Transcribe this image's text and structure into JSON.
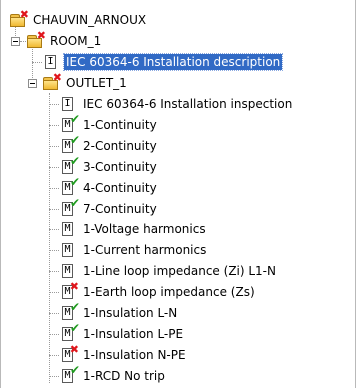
{
  "tree": {
    "root": {
      "label": "CHAUVIN_ARNOUX",
      "icon": "folder-error-icon"
    },
    "room": {
      "label": "ROOM_1",
      "icon": "folder-error-icon"
    },
    "room_description": {
      "label": "IEC 60364-6 Installation description",
      "icon": "info-document-icon",
      "letter": "I",
      "selected": true
    },
    "outlet": {
      "label": "OUTLET_1",
      "icon": "folder-error-icon"
    },
    "outlet_items": [
      {
        "label": "IEC 60364-6 Installation inspection",
        "letter": "I",
        "status": "none"
      },
      {
        "label": "1-Continuity",
        "letter": "M",
        "status": "pass"
      },
      {
        "label": "2-Continuity",
        "letter": "M",
        "status": "pass"
      },
      {
        "label": "3-Continuity",
        "letter": "M",
        "status": "pass"
      },
      {
        "label": "4-Continuity",
        "letter": "M",
        "status": "pass"
      },
      {
        "label": "7-Continuity",
        "letter": "M",
        "status": "pass"
      },
      {
        "label": "1-Voltage harmonics",
        "letter": "M",
        "status": "none"
      },
      {
        "label": "1-Current harmonics",
        "letter": "M",
        "status": "none"
      },
      {
        "label": "1-Line loop impedance (Zi) L1-N",
        "letter": "M",
        "status": "none"
      },
      {
        "label": "1-Earth loop impedance (Zs)",
        "letter": "M",
        "status": "fail"
      },
      {
        "label": "1-Insulation L-N",
        "letter": "M",
        "status": "pass"
      },
      {
        "label": "1-Insulation L-PE",
        "letter": "M",
        "status": "pass"
      },
      {
        "label": "1-Insulation N-PE",
        "letter": "M",
        "status": "fail"
      },
      {
        "label": "1-RCD No trip",
        "letter": "M",
        "status": "pass"
      }
    ]
  },
  "colors": {
    "selection": "#316ac5",
    "pass": "#1f9a1f",
    "fail": "#e0161c",
    "folder": "#f0b932"
  }
}
